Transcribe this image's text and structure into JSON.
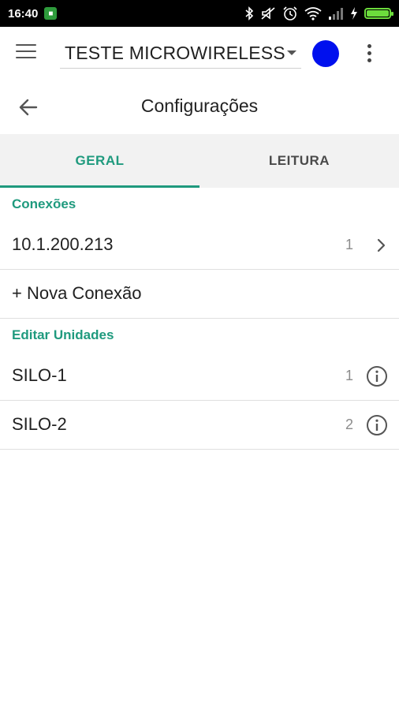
{
  "status_bar": {
    "time": "16:40",
    "app_icon": "notification-app-icon",
    "icons": [
      "bluetooth-icon",
      "mute-icon",
      "alarm-icon",
      "wifi-icon",
      "signal-icon",
      "charging-icon",
      "battery-icon"
    ],
    "battery_level": 1.0,
    "battery_color": "#6cdc3c"
  },
  "app_bar": {
    "menu_icon": "hamburger-menu-icon",
    "selected_device": "TESTE MICROWIRELESS",
    "status_color": "#0010ee",
    "overflow_icon": "more-vert-icon"
  },
  "page": {
    "back_icon": "arrow-back-icon",
    "title": "Configurações"
  },
  "tabs": [
    {
      "label": "GERAL",
      "active": true
    },
    {
      "label": "LEITURA",
      "active": false
    }
  ],
  "accent_color": "#1f9a7e",
  "connections": {
    "header": "Conexões",
    "items": [
      {
        "label": "10.1.200.213",
        "count": "1"
      }
    ],
    "new_connection": "+ Nova Conexão"
  },
  "units": {
    "header": "Editar Unidades",
    "items": [
      {
        "label": "SILO-1",
        "count": "1"
      },
      {
        "label": "SILO-2",
        "count": "2"
      }
    ]
  }
}
